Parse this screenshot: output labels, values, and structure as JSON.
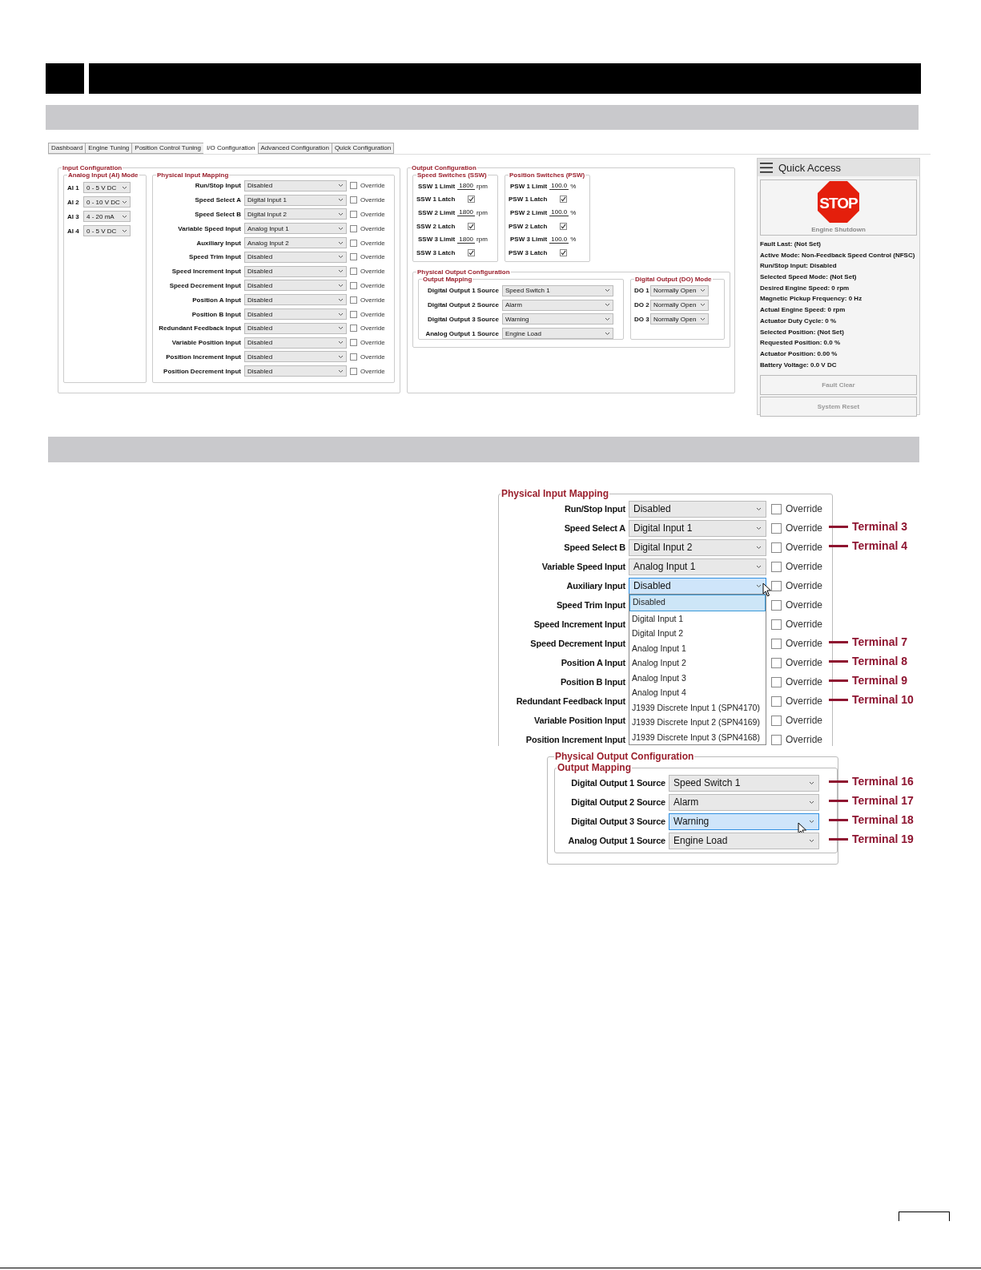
{
  "app": {
    "tabs": [
      {
        "label": "Dashboard",
        "selected": false
      },
      {
        "label": "Engine Tuning",
        "selected": false
      },
      {
        "label": "Position Control Tuning",
        "selected": false
      },
      {
        "label": "I/O Configuration",
        "selected": true
      },
      {
        "label": "Advanced Configuration",
        "selected": false
      },
      {
        "label": "Quick Configuration",
        "selected": false
      }
    ],
    "input_configuration": {
      "title": "Input Configuration",
      "ai_mode": {
        "title": "Analog Input (AI) Mode",
        "rows": [
          {
            "label": "AI 1",
            "value": "0 - 5 V DC"
          },
          {
            "label": "AI 2",
            "value": "0 - 10 V DC"
          },
          {
            "label": "AI 3",
            "value": "4 - 20 mA"
          },
          {
            "label": "AI 4",
            "value": "0 - 5 V DC"
          }
        ]
      },
      "mapping": {
        "title": "Physical Input Mapping",
        "rows": [
          {
            "label": "Run/Stop Input",
            "value": "Disabled",
            "override": false,
            "override_label": "Override"
          },
          {
            "label": "Speed Select A",
            "value": "Digital Input 1",
            "override": false,
            "override_label": "Override"
          },
          {
            "label": "Speed Select B",
            "value": "Digital Input 2",
            "override": false,
            "override_label": "Override"
          },
          {
            "label": "Variable Speed Input",
            "value": "Analog Input 1",
            "override": false,
            "override_label": "Override"
          },
          {
            "label": "Auxiliary Input",
            "value": "Analog Input 2",
            "override": false,
            "override_label": "Override"
          },
          {
            "label": "Speed Trim Input",
            "value": "Disabled",
            "override": false,
            "override_label": "Override"
          },
          {
            "label": "Speed Increment Input",
            "value": "Disabled",
            "override": false,
            "override_label": "Override"
          },
          {
            "label": "Speed Decrement Input",
            "value": "Disabled",
            "override": false,
            "override_label": "Override"
          },
          {
            "label": "Position A Input",
            "value": "Disabled",
            "override": false,
            "override_label": "Override"
          },
          {
            "label": "Position B Input",
            "value": "Disabled",
            "override": false,
            "override_label": "Override"
          },
          {
            "label": "Redundant Feedback Input",
            "value": "Disabled",
            "override": false,
            "override_label": "Override"
          },
          {
            "label": "Variable Position Input",
            "value": "Disabled",
            "override": false,
            "override_label": "Override"
          },
          {
            "label": "Position Increment Input",
            "value": "Disabled",
            "override": false,
            "override_label": "Override"
          },
          {
            "label": "Position Decrement Input",
            "value": "Disabled",
            "override": false,
            "override_label": "Override"
          }
        ]
      }
    },
    "output_configuration": {
      "title": "Output Configuration",
      "speed_switches": {
        "title": "Speed Switches (SSW)",
        "rows": [
          {
            "kind": "limit",
            "label": "SSW 1 Limit",
            "value": "1800",
            "unit": "rpm"
          },
          {
            "kind": "latch",
            "label": "SSW 1 Latch",
            "checked": true
          },
          {
            "kind": "limit",
            "label": "SSW 2 Limit",
            "value": "1800",
            "unit": "rpm"
          },
          {
            "kind": "latch",
            "label": "SSW 2 Latch",
            "checked": true
          },
          {
            "kind": "limit",
            "label": "SSW 3 Limit",
            "value": "1800",
            "unit": "rpm"
          },
          {
            "kind": "latch",
            "label": "SSW 3 Latch",
            "checked": true
          }
        ]
      },
      "position_switches": {
        "title": "Position Switches (PSW)",
        "rows": [
          {
            "kind": "limit",
            "label": "PSW 1 Limit",
            "value": "100.0",
            "unit": "%"
          },
          {
            "kind": "latch",
            "label": "PSW 1 Latch",
            "checked": true
          },
          {
            "kind": "limit",
            "label": "PSW 2 Limit",
            "value": "100.0",
            "unit": "%"
          },
          {
            "kind": "latch",
            "label": "PSW 2 Latch",
            "checked": true
          },
          {
            "kind": "limit",
            "label": "PSW 3 Limit",
            "value": "100.0",
            "unit": "%"
          },
          {
            "kind": "latch",
            "label": "PSW 3 Latch",
            "checked": true
          }
        ]
      },
      "physical_output": {
        "title": "Physical Output Configuration",
        "output_mapping": {
          "title": "Output Mapping",
          "rows": [
            {
              "label": "Digital Output 1 Source",
              "value": "Speed Switch 1"
            },
            {
              "label": "Digital Output 2 Source",
              "value": "Alarm"
            },
            {
              "label": "Digital Output 3 Source",
              "value": "Warning"
            },
            {
              "label": "Analog Output 1 Source",
              "value": "Engine Load"
            }
          ]
        },
        "do_mode": {
          "title": "Digital Output (DO) Mode",
          "rows": [
            {
              "label": "DO 1",
              "value": "Normally Open"
            },
            {
              "label": "DO 2",
              "value": "Normally Open"
            },
            {
              "label": "DO 3",
              "value": "Normally Open"
            }
          ]
        }
      }
    },
    "quick_access": {
      "title": "Quick Access",
      "stop_sign": "STOP",
      "shutdown_label": "Engine Shutdown",
      "status_lines": [
        "Fault Last: (Not Set)",
        "Active Mode: Non-Feedback Speed Control (NFSC)",
        "Run/Stop Input: Disabled",
        "Selected Speed Mode: (Not Set)",
        "Desired Engine Speed: 0 rpm",
        "Magnetic Pickup Frequency: 0 Hz",
        "Actual Engine Speed: 0 rpm",
        "Actuator Duty Cycle: 0 %",
        "Selected Position: (Not Set)",
        "Requested Position: 0.0 %",
        "Actuator Position: 0.00 %",
        "Battery Voltage: 0.0 V DC"
      ],
      "buttons": [
        "Fault Clear",
        "System Reset"
      ]
    }
  },
  "detail_input": {
    "title": "Physical Input Mapping",
    "rows": [
      {
        "label": "Run/Stop Input",
        "value": "Disabled",
        "override": false,
        "override_label": "Override",
        "focused": false
      },
      {
        "label": "Speed Select A",
        "value": "Digital Input 1",
        "override": false,
        "override_label": "Override",
        "focused": false,
        "terminal": "Terminal 3"
      },
      {
        "label": "Speed Select B",
        "value": "Digital Input 2",
        "override": false,
        "override_label": "Override",
        "focused": false,
        "terminal": "Terminal 4"
      },
      {
        "label": "Variable Speed Input",
        "value": "Analog Input 1",
        "override": false,
        "override_label": "Override",
        "focused": false
      },
      {
        "label": "Auxiliary Input",
        "value": "Disabled",
        "override": false,
        "override_label": "Override",
        "focused": true
      },
      {
        "label": "Speed Trim Input",
        "override": false,
        "override_label": "Override"
      },
      {
        "label": "Speed Increment Input",
        "override": false,
        "override_label": "Override"
      },
      {
        "label": "Speed Decrement Input",
        "override": false,
        "override_label": "Override",
        "terminal": "Terminal 7"
      },
      {
        "label": "Position A Input",
        "override": false,
        "override_label": "Override",
        "terminal": "Terminal 8"
      },
      {
        "label": "Position B Input",
        "override": false,
        "override_label": "Override",
        "terminal": "Terminal 9"
      },
      {
        "label": "Redundant Feedback Input",
        "override": false,
        "override_label": "Override",
        "terminal": "Terminal 10"
      },
      {
        "label": "Variable Position Input",
        "override": false,
        "override_label": "Override"
      },
      {
        "label": "Position Increment Input",
        "override": false,
        "override_label": "Override"
      }
    ],
    "dropdown": {
      "items": [
        {
          "label": "Disabled",
          "selected": true
        },
        {
          "label": "Digital Input 1",
          "selected": false
        },
        {
          "label": "Digital Input 2",
          "selected": false
        },
        {
          "label": "Analog Input 1",
          "selected": false
        },
        {
          "label": "Analog Input 2",
          "selected": false
        },
        {
          "label": "Analog Input 3",
          "selected": false
        },
        {
          "label": "Analog Input 4",
          "selected": false
        },
        {
          "label": "J1939 Discrete Input 1 (SPN4170)",
          "selected": false
        },
        {
          "label": "J1939 Discrete Input 2 (SPN4169)",
          "selected": false
        },
        {
          "label": "J1939 Discrete Input 3 (SPN4168)",
          "selected": false
        }
      ]
    }
  },
  "detail_output": {
    "title": "Physical Output Configuration",
    "mapping_title": "Output Mapping",
    "rows": [
      {
        "label": "Digital Output 1 Source",
        "value": "Speed Switch 1",
        "focused": false,
        "terminal": "Terminal 16"
      },
      {
        "label": "Digital Output 2 Source",
        "value": "Alarm",
        "focused": false,
        "terminal": "Terminal 17"
      },
      {
        "label": "Digital Output 3 Source",
        "value": "Warning",
        "focused": true,
        "terminal": "Terminal 18"
      },
      {
        "label": "Analog Output 1 Source",
        "value": "Engine Load",
        "focused": false,
        "terminal": "Terminal 19"
      }
    ]
  }
}
